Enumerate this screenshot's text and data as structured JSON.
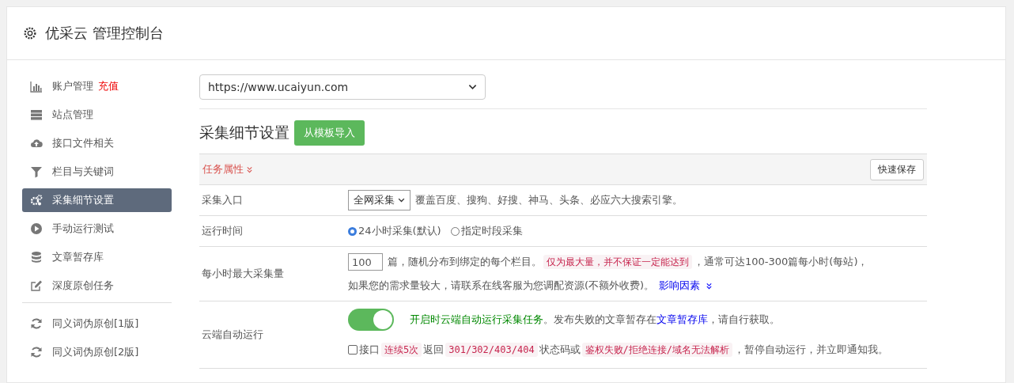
{
  "header": {
    "title": "优采云 管理控制台"
  },
  "sidebar": {
    "sections": [
      [
        {
          "label": "账户管理",
          "badge": "充值",
          "selected": false
        },
        {
          "label": "站点管理",
          "selected": false
        },
        {
          "label": "接口文件相关",
          "selected": false
        },
        {
          "label": "栏目与关键词",
          "selected": false
        },
        {
          "label": "采集细节设置",
          "selected": true
        },
        {
          "label": "手动运行测试",
          "selected": false
        },
        {
          "label": "文章暂存库",
          "selected": false
        },
        {
          "label": "深度原创任务",
          "selected": false
        }
      ],
      [
        {
          "label": "同义词伪原创[1版]",
          "selected": false
        },
        {
          "label": "同义词伪原创[2版]",
          "selected": false
        }
      ]
    ]
  },
  "site_select": {
    "value": "https://www.ucaiyun.com"
  },
  "section": {
    "title": "采集细节设置",
    "import_button": "从模板导入"
  },
  "panel": {
    "title": "任务属性",
    "save_button": "快速保存"
  },
  "rows": [
    {
      "kind": "select",
      "label": "采集入口",
      "value": "全网采集",
      "note": "覆盖百度、搜狗、好搜、神马、头条、必应六大搜索引擎。"
    },
    {
      "kind": "radio",
      "label": "运行时间",
      "options": [
        {
          "label": "24小时采集(默认)",
          "selected": true
        },
        {
          "label": "指定时段采集",
          "selected": false
        }
      ]
    },
    {
      "kind": "number",
      "label": "每小时最大采集量",
      "value": "100",
      "lines": [
        [
          {
            "kind": "plain",
            "text": "篇，随机分布到绑定的每个栏目。"
          },
          {
            "kind": "code",
            "text": "仅为最大量，并不保证一定能达到"
          },
          {
            "kind": "plain",
            "text": "，通常可达100-300篇每小时(每站)，"
          }
        ],
        [
          {
            "kind": "plain",
            "text": "如果您的需求量较大，请联系在线客服为您调配资源(不额外收费)。"
          },
          {
            "kind": "link",
            "text": "影响因素"
          }
        ]
      ]
    },
    {
      "kind": "toggle",
      "label": "云端自动运行",
      "on": true,
      "lines": [
        [
          {
            "kind": "green",
            "text": "开启时云端自动运行采集任务"
          },
          {
            "kind": "plain",
            "text": "。发布失败的文章暂存在"
          },
          {
            "kind": "link",
            "text": "文章暂存库"
          },
          {
            "kind": "plain",
            "text": "，请自行获取。"
          }
        ]
      ],
      "check": {
        "label": "接口",
        "checked": false,
        "segments": [
          {
            "kind": "code",
            "text": "连续5次"
          },
          {
            "kind": "plain",
            "text": "返回"
          },
          {
            "kind": "code",
            "text": "301/302/403/404"
          },
          {
            "kind": "plain",
            "text": "状态码或"
          },
          {
            "kind": "code",
            "text": "鉴权失败/拒绝连接/域名无法解析"
          },
          {
            "kind": "plain",
            "text": "，暂停自动运行，并立即通知我。"
          }
        ]
      }
    }
  ]
}
